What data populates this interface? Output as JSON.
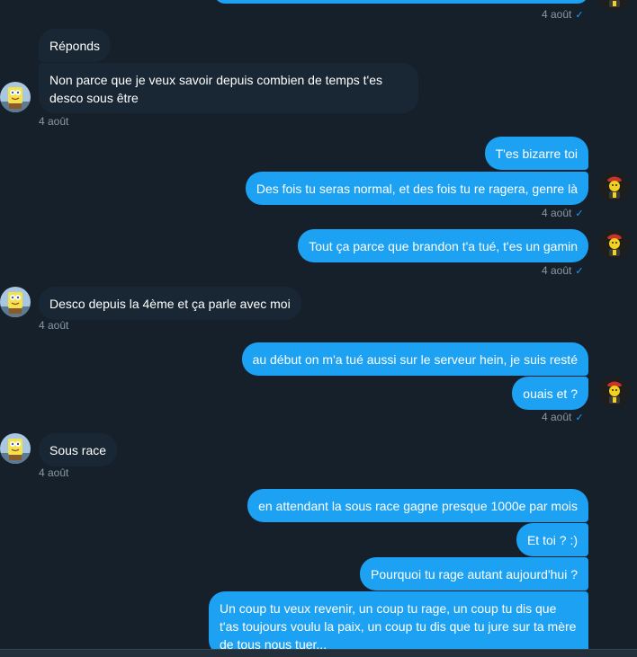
{
  "conversation": {
    "top": {
      "time": "4 août",
      "check": "✓"
    },
    "m1": {
      "text": "Réponds"
    },
    "m2": {
      "text": "Non parce que je veux savoir depuis combien de temps t'es desco sous être"
    },
    "t2": {
      "time": "4 août"
    },
    "m3": {
      "text": "T'es bizarre toi"
    },
    "m4": {
      "text": "Des fois tu seras normal, et des fois tu re ragera, genre là"
    },
    "t4": {
      "time": "4 août",
      "check": "✓"
    },
    "m5": {
      "text": "Tout ça parce que brandon t'a tué, t'es un gamin"
    },
    "t5": {
      "time": "4 août",
      "check": "✓"
    },
    "m6": {
      "text": "Desco depuis la 4ème et ça parle avec moi"
    },
    "t6": {
      "time": "4 août"
    },
    "m7": {
      "text": "au début on m'a tué aussi sur le serveur hein, je suis resté"
    },
    "m8": {
      "text": "ouais et ?"
    },
    "t8": {
      "time": "4 août",
      "check": "✓"
    },
    "m9": {
      "text": "Sous race"
    },
    "t9": {
      "time": "4 août"
    },
    "m10": {
      "text": "en attendant la sous race gagne presque 1000e par mois"
    },
    "m11": {
      "text": "Et toi ? :)"
    },
    "m12": {
      "text": "Pourquoi tu rage autant aujourd'hui ?"
    },
    "m13": {
      "text": "Un coup tu veux revenir, un coup tu rage, un coup tu dis que t'as toujours voulu la paix, un coup tu dis que tu jure sur ta mère de tous nous tuer..."
    }
  },
  "avatars": {
    "other": "spongebob-avatar",
    "me": "emoji-character-avatar"
  },
  "colors": {
    "background": "#15202b",
    "incoming_bubble": "#192734",
    "outgoing_bubble": "#1da1f2",
    "timestamp": "#8899a6"
  }
}
